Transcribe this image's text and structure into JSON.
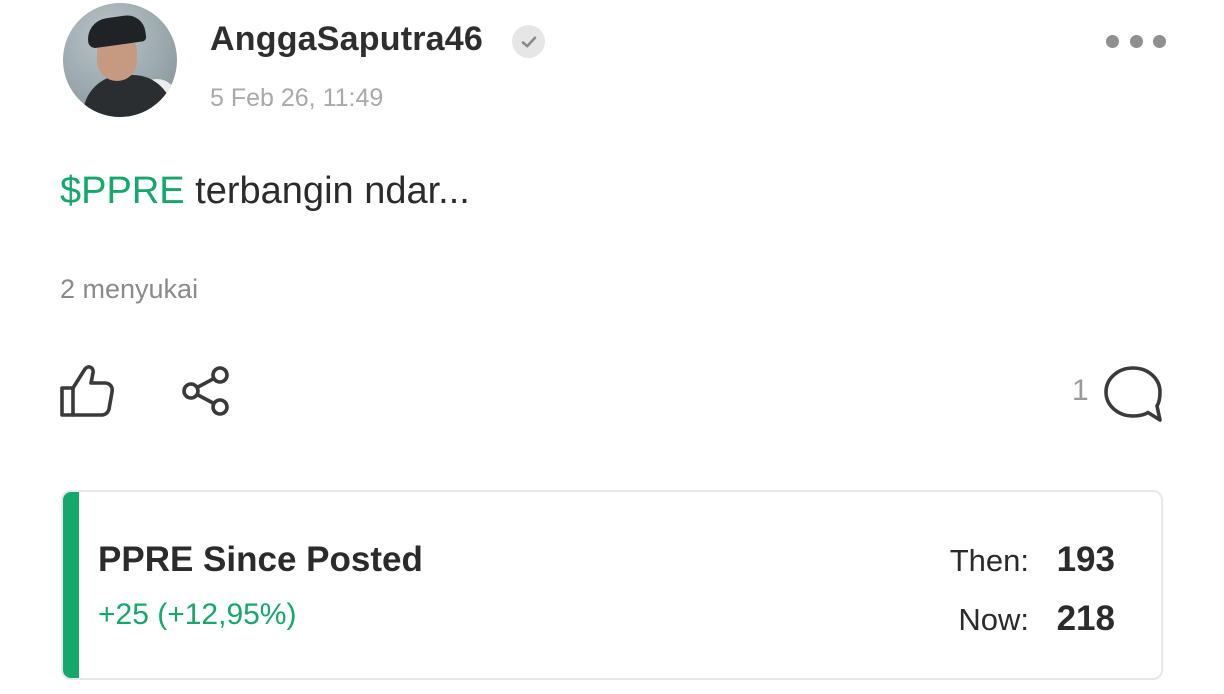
{
  "post": {
    "author": {
      "username": "AnggaSaputra46",
      "verified": true
    },
    "timestamp": "5 Feb 26, 11:49",
    "body": {
      "ticker": "$PPRE",
      "text": " terbangin ndar..."
    },
    "likes_text": "2 menyukai",
    "comment_count": "1"
  },
  "icons": {
    "avatar": "user-avatar-photo",
    "verified": "verified-check-icon",
    "more": "more-horizontal-icon",
    "like": "thumbs-up-icon",
    "share": "share-icon",
    "comment": "comment-bubble-icon"
  },
  "stock_card": {
    "title": "PPRE Since Posted",
    "change": "+25 (+12,95%)",
    "then_label": "Then:",
    "then_value": "193",
    "now_label": "Now:",
    "now_value": "218"
  },
  "colors": {
    "accent_green": "#14a86a",
    "text_dark": "#2b2b2b",
    "text_muted": "#a9a9a9"
  }
}
